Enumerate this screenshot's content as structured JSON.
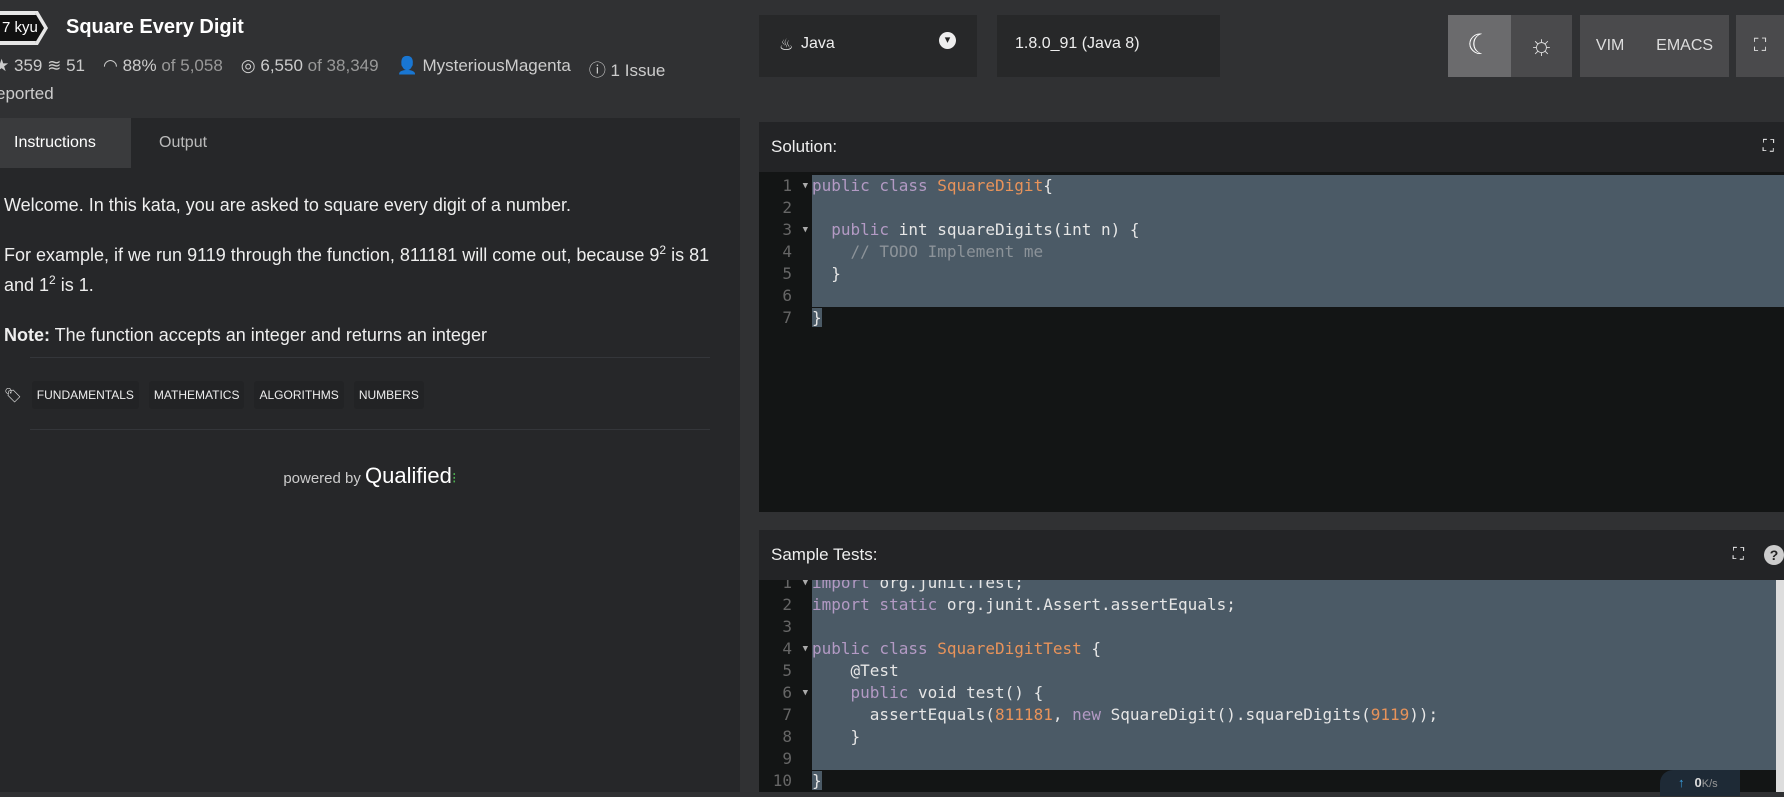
{
  "kata": {
    "rank": "7 kyu",
    "title": "Square Every Digit",
    "stars": "359",
    "collections": "51",
    "satisfaction": "88%",
    "satisfaction_of": "of 5,058",
    "completed": "6,550",
    "completed_of": "of 38,349",
    "author": "MysteriousMagenta",
    "issues": "1 Issue",
    "issues_cont": "eported"
  },
  "toolbar": {
    "language": "Java",
    "version": "1.8.0_91 (Java 8)",
    "vim": "VIM",
    "emacs": "EMACS",
    "theme_dark_active": true
  },
  "tabs": [
    {
      "label": "Instructions",
      "active": true
    },
    {
      "label": "Output",
      "active": false
    }
  ],
  "instructions": {
    "p1": "Welcome. In this kata, you are asked to square every digit of a number.",
    "p2a": "For example, if we run 9119 through the function, 811181 will come out, because 9",
    "p2b": " is 81 and 1",
    "p2c": " is 1.",
    "sup": "2",
    "note_label": "Note:",
    "note": " The function accepts an integer and returns an integer"
  },
  "tags": [
    "FUNDAMENTALS",
    "MATHEMATICS",
    "ALGORITHMS",
    "NUMBERS"
  ],
  "powered": {
    "by": "powered by",
    "brand": "Qualified"
  },
  "solution": {
    "title": "Solution:",
    "lines": [
      [
        [
          "kw",
          "public class "
        ],
        [
          "cls",
          "SquareDigit"
        ],
        [
          "",
          "{"
        ]
      ],
      [],
      [
        [
          "",
          "  "
        ],
        [
          "kw",
          "public "
        ],
        [
          "",
          "int squareDigits(int n) {"
        ]
      ],
      [
        [
          "cm",
          "    // TODO Implement me"
        ]
      ],
      [
        [
          "",
          "  }"
        ]
      ],
      [],
      [
        [
          "",
          "}"
        ]
      ]
    ],
    "folds": [
      1,
      3
    ]
  },
  "tests": {
    "title": "Sample Tests:",
    "lines": [
      [
        [
          "kw",
          "import "
        ],
        [
          "",
          "org.junit.Test;"
        ]
      ],
      [
        [
          "kw",
          "import static "
        ],
        [
          "",
          "org.junit.Assert.assertEquals;"
        ]
      ],
      [],
      [
        [
          "kw",
          "public class "
        ],
        [
          "cls",
          "SquareDigitTest "
        ],
        [
          "",
          "{"
        ]
      ],
      [
        [
          "",
          "    @Test"
        ]
      ],
      [
        [
          "",
          "    "
        ],
        [
          "kw",
          "public "
        ],
        [
          "",
          "void test() {"
        ]
      ],
      [
        [
          "",
          "      assertEquals("
        ],
        [
          "num",
          "811181"
        ],
        [
          "",
          ", "
        ],
        [
          "kw",
          "new "
        ],
        [
          "",
          "SquareDigit().squareDigits("
        ],
        [
          "num",
          "9119"
        ],
        [
          "",
          "));"
        ]
      ],
      [
        [
          "",
          "    }"
        ]
      ],
      [],
      [
        [
          "",
          "}"
        ]
      ]
    ],
    "folds": [
      1,
      4,
      6
    ]
  },
  "network": {
    "speed": "0",
    "unit": "K/s"
  }
}
